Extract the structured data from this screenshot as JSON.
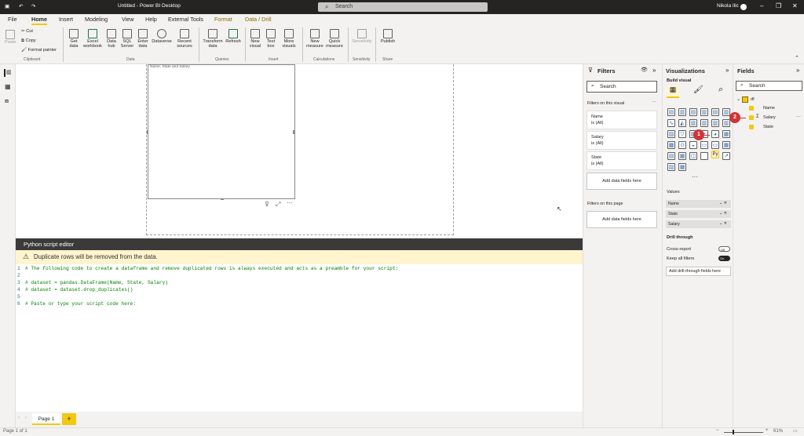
{
  "title_bar": {
    "doc_title": "Untitled - Power BI Desktop",
    "search_placeholder": "Search",
    "user": "Nikola Ilic"
  },
  "tabs": [
    "File",
    "Home",
    "Insert",
    "Modeling",
    "View",
    "Help",
    "External Tools",
    "Format",
    "Data / Drill"
  ],
  "ribbon": {
    "clipboard": {
      "paste": "Paste",
      "cut": "Cut",
      "copy": "Copy",
      "format_painter": "Format painter",
      "group": "Clipboard"
    },
    "data": {
      "items": [
        "Get data",
        "Excel workbook",
        "Data hub",
        "SQL Server",
        "Enter data",
        "Dataverse",
        "Recent sources"
      ],
      "group": "Data"
    },
    "queries": {
      "items": [
        "Transform data",
        "Refresh"
      ],
      "group": "Queries"
    },
    "insert": {
      "items": [
        "New visual",
        "Text box",
        "More visuals"
      ],
      "group": "Insert"
    },
    "calculations": {
      "items": [
        "New measure",
        "Quick measure"
      ],
      "group": "Calculations"
    },
    "sensitivity": {
      "items": [
        "Sensitivity"
      ],
      "group": "Sensitivity"
    },
    "share": {
      "items": [
        "Publish"
      ],
      "group": "Share"
    }
  },
  "visual": {
    "title": "Name, State and Salary"
  },
  "python_editor": {
    "title": "Python script editor",
    "warning": "Duplicate rows will be removed from the data.",
    "lines": [
      {
        "n": "1",
        "text": "# The following code to create a dataframe and remove duplicated rows is always executed and acts as a preamble for your script:"
      },
      {
        "n": "2",
        "text": ""
      },
      {
        "n": "3",
        "text": "# dataset = pandas.DataFrame(Name, State, Salary)"
      },
      {
        "n": "4",
        "text": "# dataset = dataset.drop_duplicates()"
      },
      {
        "n": "5",
        "text": ""
      },
      {
        "n": "6",
        "text": "# Paste or type your script code here:"
      }
    ]
  },
  "pages": {
    "tab": "Page 1",
    "add": "+"
  },
  "status": {
    "page": "Page 1 of 1",
    "zoom": "61%"
  },
  "filters": {
    "title": "Filters",
    "search": "Search",
    "on_visual": "Filters on this visual",
    "cards": [
      {
        "name": "Name",
        "value": "is (All)"
      },
      {
        "name": "Salary",
        "value": "is (All)"
      },
      {
        "name": "State",
        "value": "is (All)"
      }
    ],
    "add_visual": "Add data fields here",
    "on_page": "Filters on this page",
    "add_page": "Add data fields here"
  },
  "visualizations": {
    "title": "Visualizations",
    "build": "Build visual",
    "values_label": "Values",
    "wells": [
      "Name",
      "State",
      "Salary"
    ],
    "drill_title": "Drill through",
    "cross_report": "Cross-report",
    "cross_state": "Off",
    "keep_filters": "Keep all filters",
    "keep_state": "On",
    "add_drill": "Add drill-through fields here",
    "more": "···"
  },
  "fields": {
    "title": "Fields",
    "search": "Search",
    "table": "df",
    "items": [
      "Name",
      "Salary",
      "State"
    ]
  },
  "badges": {
    "one": "1",
    "two": "2"
  }
}
